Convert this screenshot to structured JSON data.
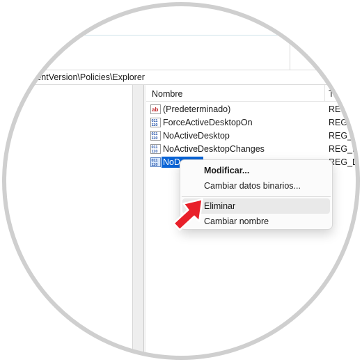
{
  "address": {
    "path": "rrentVersion\\Policies\\Explorer"
  },
  "columns": {
    "name": "Nombre",
    "type": "Ti"
  },
  "values": [
    {
      "name": "(Predeterminado)",
      "type": "REG_",
      "icon": "string-value-icon"
    },
    {
      "name": "ForceActiveDesktopOn",
      "type": "REG_D",
      "icon": "binary-value-icon"
    },
    {
      "name": "NoActiveDesktop",
      "type": "REG_D",
      "icon": "binary-value-icon"
    },
    {
      "name": "NoActiveDesktopChanges",
      "type": "REG_DV",
      "icon": "binary-value-icon"
    },
    {
      "name": "NoD",
      "type": "REG_DV",
      "icon": "binary-value-icon",
      "selected": true
    }
  ],
  "context_menu": {
    "modify": "Modificar...",
    "modify_binary": "Cambiar datos binarios...",
    "delete": "Eliminar",
    "rename": "Cambiar nombre"
  },
  "colors": {
    "selection": "#0a64d6",
    "arrow": "#e8202a",
    "ring": "#cfcfcf"
  }
}
